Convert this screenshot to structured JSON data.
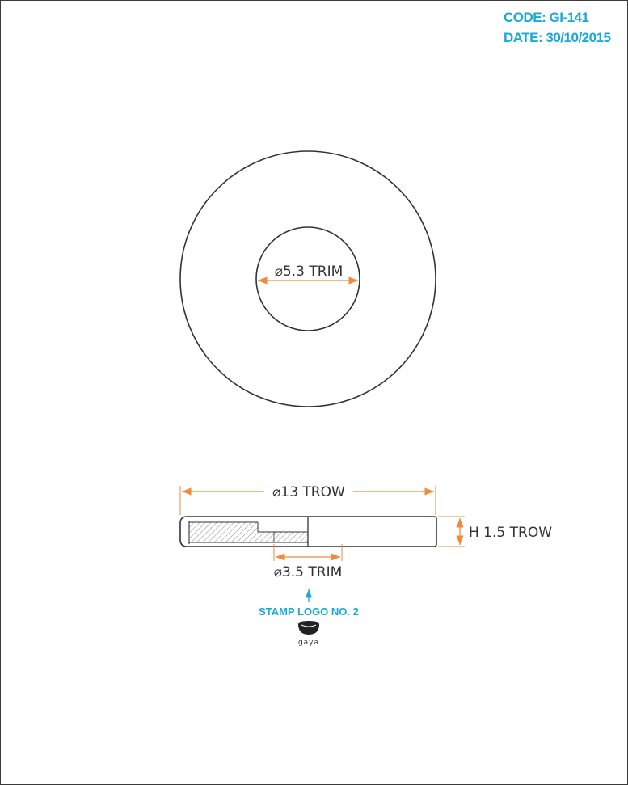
{
  "header": {
    "code": "CODE: GI-141",
    "date": "DATE: 30/10/2015"
  },
  "dimensions": {
    "inner_diameter": "⌀5.3 TRIM",
    "outer_diameter": "⌀13 TROW",
    "height": "H 1.5 TROW",
    "stamp_diameter": "⌀3.5 TRIM"
  },
  "stamp": {
    "note": "STAMP LOGO NO. 2",
    "logo_text": "gaya"
  },
  "colors": {
    "accent": "#19a9d6",
    "dimension": "#f08a3c",
    "line": "#333333"
  }
}
